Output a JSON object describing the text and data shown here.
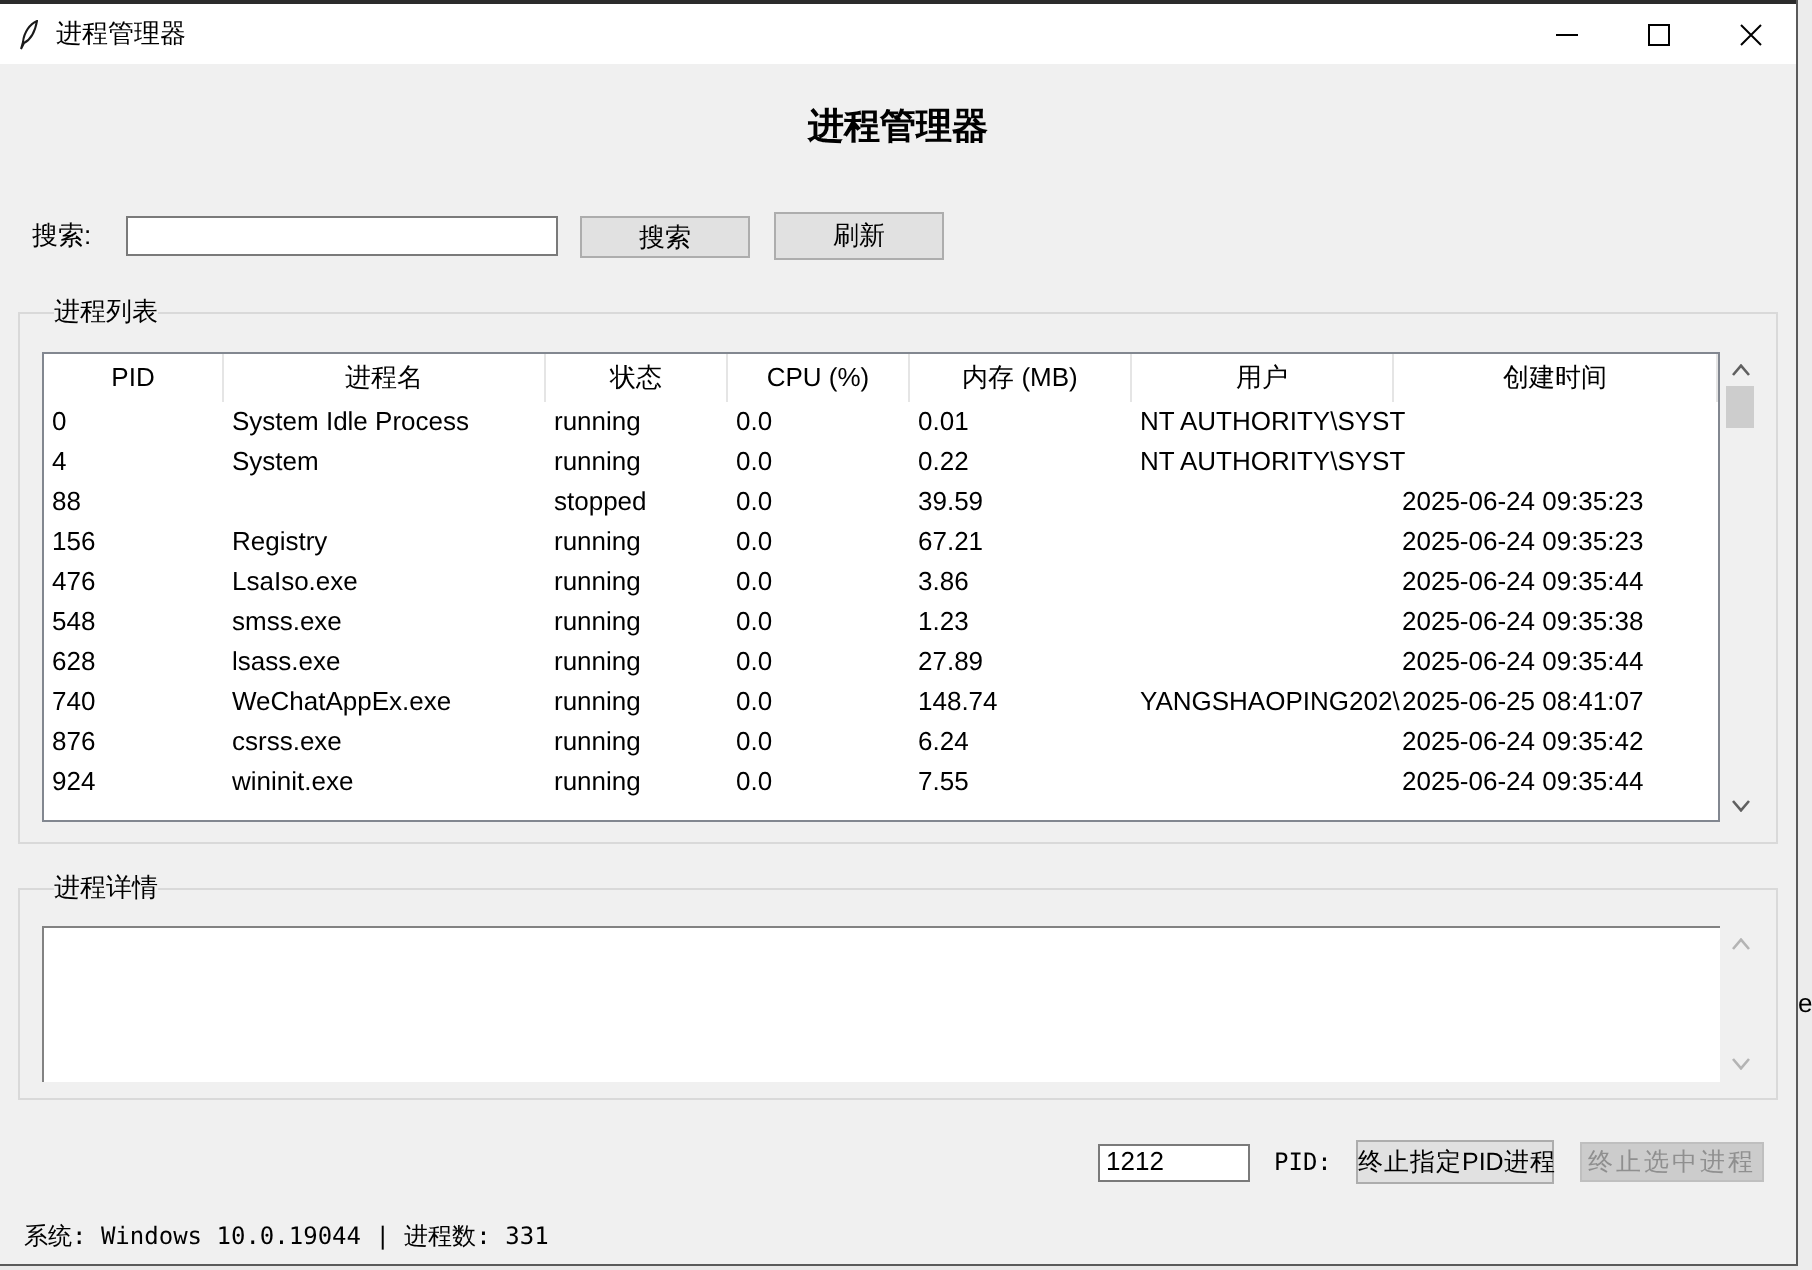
{
  "window": {
    "title": "进程管理器"
  },
  "heading": "进程管理器",
  "search": {
    "label": "搜索:",
    "buttons": [
      {
        "label": "搜索"
      },
      {
        "label": "刷新"
      }
    ]
  },
  "process_list": {
    "label": "进程列表",
    "columns": [
      "PID",
      "进程名",
      "状态",
      "CPU (%)",
      "内存 (MB)",
      "用户",
      "创建时间"
    ],
    "rows": [
      [
        "0",
        "System Idle Process",
        "running",
        "0.0",
        "0.01",
        "NT AUTHORITY\\SYST",
        null
      ],
      [
        "4",
        "System",
        "running",
        "0.0",
        "0.22",
        "NT AUTHORITY\\SYST",
        null
      ],
      [
        "88",
        null,
        "stopped",
        "0.0",
        "39.59",
        null,
        "2025-06-24 09:35:23"
      ],
      [
        "156",
        "Registry",
        "running",
        "0.0",
        "67.21",
        null,
        "2025-06-24 09:35:23"
      ],
      [
        "476",
        "LsaIso.exe",
        "running",
        "0.0",
        "3.86",
        null,
        "2025-06-24 09:35:44"
      ],
      [
        "548",
        "smss.exe",
        "running",
        "0.0",
        "1.23",
        null,
        "2025-06-24 09:35:38"
      ],
      [
        "628",
        "lsass.exe",
        "running",
        "0.0",
        "27.89",
        null,
        "2025-06-24 09:35:44"
      ],
      [
        "740",
        "WeChatAppEx.exe",
        "running",
        "0.0",
        "148.74",
        "YANGSHAOPING202\\",
        "2025-06-25 08:41:07"
      ],
      [
        "876",
        "csrss.exe",
        "running",
        "0.0",
        "6.24",
        null,
        "2025-06-24 09:35:42"
      ],
      [
        "924",
        "wininit.exe",
        "running",
        "0.0",
        "7.55",
        null,
        "2025-06-24 09:35:44"
      ]
    ]
  },
  "details": {
    "label": "进程详情"
  },
  "kill_bar": {
    "pid_value": "1212",
    "pid_label": "PID:",
    "buttons": [
      {
        "label": "终止指定PID进程",
        "disabled": false
      },
      {
        "label": "终止选中进程",
        "disabled": true
      }
    ]
  },
  "status_bar": "系统: Windows 10.0.19044 | 进程数: 331",
  "background": {
    "text": "e"
  }
}
